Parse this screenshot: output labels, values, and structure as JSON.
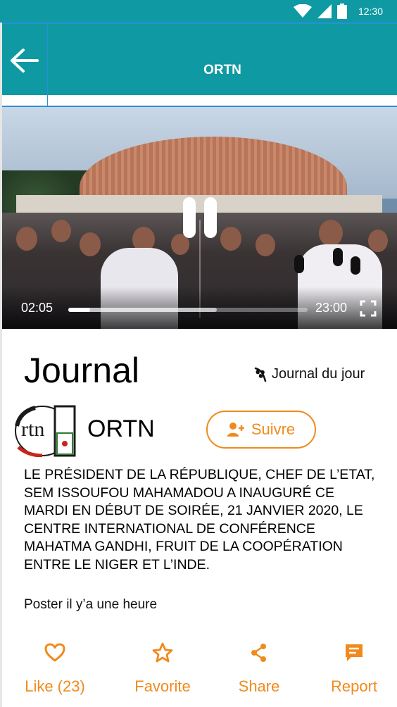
{
  "status_bar": {
    "time": "12:30"
  },
  "app_bar": {
    "title": "ORTN"
  },
  "video": {
    "current_time": "02:05",
    "total_time": "23:00",
    "progress": 0.09,
    "buffered": 0.62
  },
  "post": {
    "headline": "Journal",
    "category": "Journal du jour",
    "channel_name": "ORTN",
    "channel_logo_text": "rtn",
    "follow_label": "Suivre",
    "description": "LE PRÉSIDENT DE LA RÉPUBLIQUE, CHEF DE L’ETAT, SEM ISSOUFOU MAHAMADOU A INAUGURÉ CE MARDI EN DÉBUT DE SOIRÉE, 21 JANVIER 2020, LE CENTRE INTERNATIONAL DE CONFÉRENCE MAHATMA GANDHI, FRUIT DE LA COOPÉRATION ENTRE LE NIGER ET L’INDE.",
    "posted": "Poster il y’a une heure"
  },
  "actions": {
    "like": "Like (23)",
    "favorite": "Favorite",
    "share": "Share",
    "report": "Report"
  },
  "colors": {
    "primary": "#0f9aa3",
    "accent": "#f08a1c",
    "highlight": "#2a8fd6"
  },
  "icons": {
    "back": "arrow-left-icon",
    "pause": "pause-icon",
    "fullscreen": "fullscreen-icon",
    "category": "leaf-icon",
    "follow": "user-plus-icon",
    "like": "heart-icon",
    "favorite": "star-icon",
    "share": "share-icon",
    "report": "report-message-icon"
  }
}
